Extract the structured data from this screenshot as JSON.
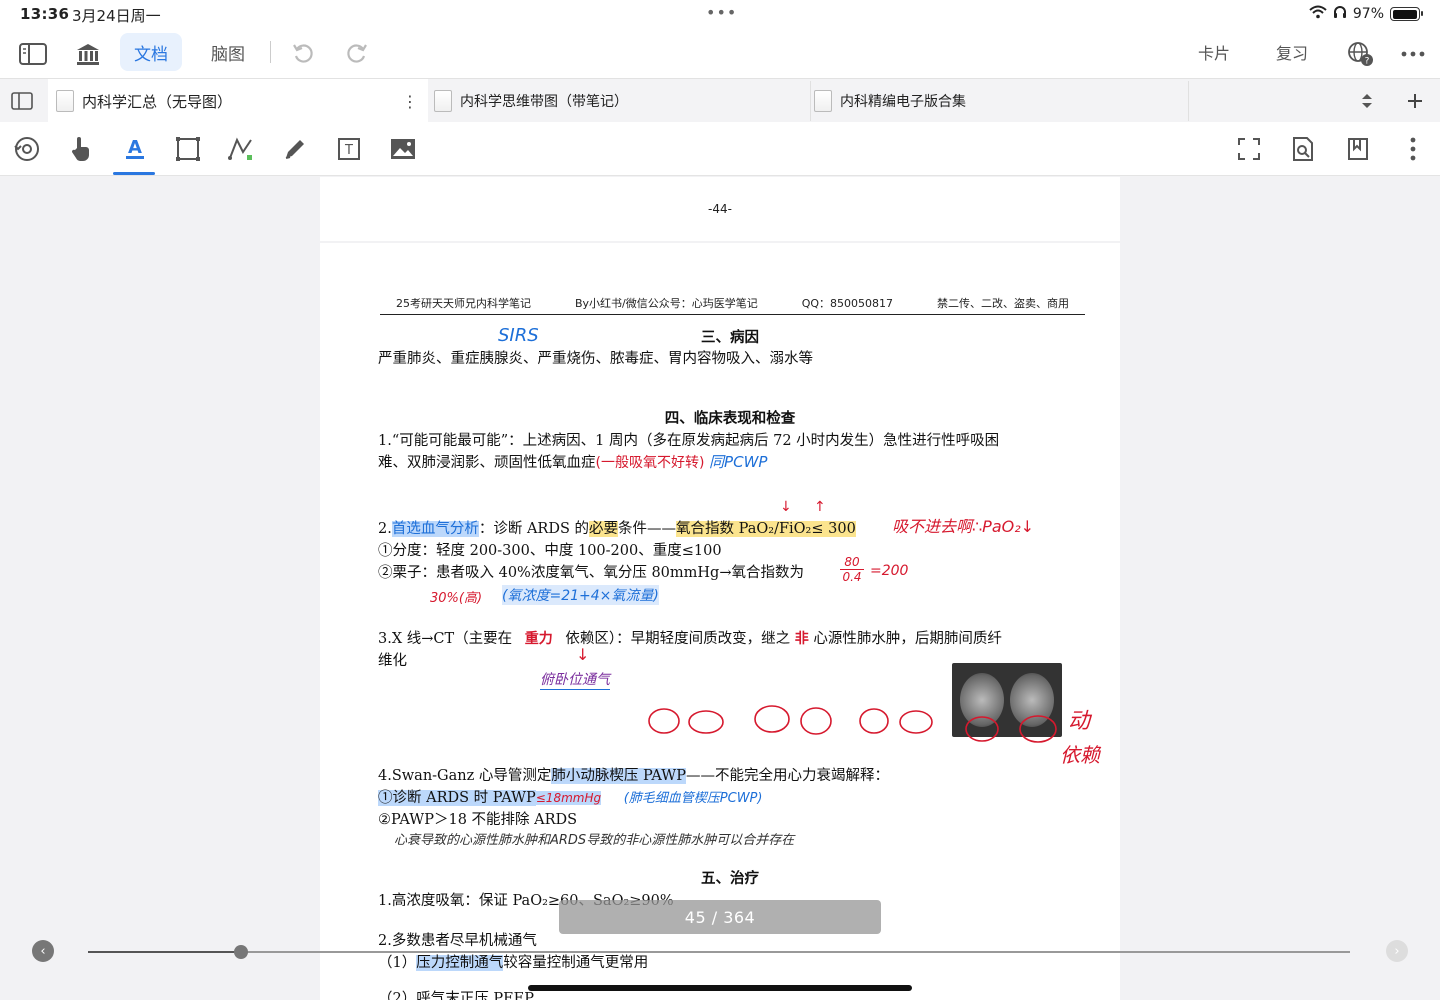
{
  "status": {
    "time": "13:36",
    "date": "3月24日周一",
    "battery": "97%",
    "battery_level": 0.97
  },
  "toolbar": {
    "doc_tab": "文档",
    "mindmap_tab": "脑图",
    "cards": "卡片",
    "review": "复习"
  },
  "tabs": [
    {
      "label": "内科学汇总（无导图）"
    },
    {
      "label": "内科学思维带图（带笔记）"
    },
    {
      "label": "内科精编电子版合集"
    }
  ],
  "page_prev": {
    "number": "-44-"
  },
  "header": {
    "left": "25考研天天师兄内科学笔记",
    "mid": "By小红书/微信公众号：心玙医学笔记",
    "qq": "QQ：850050817",
    "right": "禁二传、二改、盗卖、商用"
  },
  "sections": {
    "s3_title": "三、病因",
    "s3_text": "严重肺炎、重症胰腺炎、严重烧伤、脓毒症、胃内容物吸入、溺水等",
    "s4_title": "四、临床表现和检查",
    "l1a": "1.“可能可能最可能”：上述病因、1 周内（多在原发病起病后 72 小时内发生）急性进行性呼吸困",
    "l1b": "难、双肺浸润影、顽固性低氧血症",
    "l2_prefix": "2.",
    "l2_hl": "首选血气分析",
    "l2_mid": "：诊断 ARDS 的",
    "l2_hl2": "必要",
    "l2_mid2": "条件——",
    "l2_hl3": "氧合指数 PaO₂/FiO₂≤ 300",
    "l3": "①分度：轻度 200-300、中度 100-200、重度≤100",
    "l4": "②栗子：患者吸入 40%浓度氧气、氧分压 80mmHg→氧合指数为",
    "l5a": "3.X 线→CT（主要在",
    "l5b": "依赖区）：早期轻度间质改变，继之",
    "l5c": "心源性肺水肿，后期肺间质纤",
    "l5d": "维化",
    "l6a": "4.Swan-Ganz 心导管测定",
    "l6hl": "肺小动脉楔压 PAWP",
    "l6b": "——不能完全用心力衰竭解释：",
    "l7": "①诊断 ARDS 时 PAWP",
    "l8": "②PAWP＞18 不能排除 ARDS",
    "s5_title": "五、治疗",
    "t1": "1.高浓度吸氧：保证 PaO₂≥60、SaO₂≥90%",
    "t2": "2.多数患者尽早机械通气",
    "t3a": "（1）",
    "t3hl": "压力控制通气",
    "t3b": "较容量控制通气更常用",
    "t4": "（2）呼气末正压 PEEP"
  },
  "handwriting": {
    "sirs": "SIRS",
    "general_o2": "(一般吸氧不好转)",
    "pcwp_short": "同PCWP",
    "note_right": "吸不进去啊∴PaO₂↓",
    "fraction_num": "80",
    "fraction_den": "0.4",
    "fraction_res": "=200",
    "thirty": "30%(高)",
    "o2_formula": "(氧浓度=21+4×氧流量)",
    "heavy": "重力",
    "non": "非",
    "prone": "俯卧位通气",
    "pawp_val": "≤18mmHg",
    "pcwp_full": "(肺毛细血管楔压PCWP)",
    "cardio_note": "心衰导致的心源性肺水肿和ARDS导致的非心源性肺水肿可以合并存在",
    "move": "动",
    "move2": "依赖"
  },
  "pager": {
    "label": "45 / 364",
    "current": 45,
    "total": 364
  }
}
